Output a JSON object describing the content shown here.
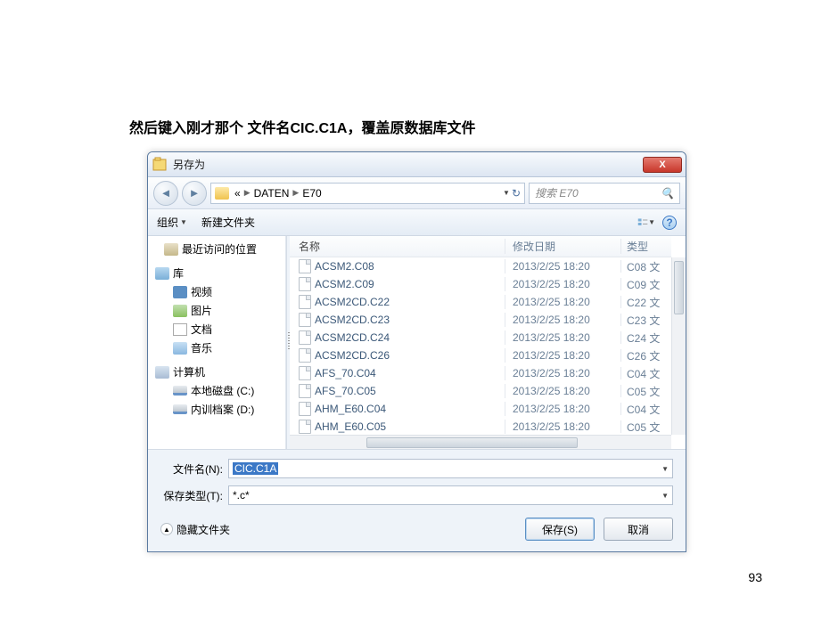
{
  "instruction": "然后键入刚才那个 文件名CIC.C1A，覆盖原数据库文件",
  "page_number": "93",
  "dialog": {
    "title": "另存为",
    "close_x": "X",
    "nav": {
      "bc_prefix": "«",
      "bc_part1": "DATEN",
      "bc_part2": "E70",
      "search_placeholder": "搜索 E70"
    },
    "toolbar": {
      "organize": "组织",
      "newfolder": "新建文件夹"
    },
    "sidebar": {
      "recent": "最近访问的位置",
      "libraries": "库",
      "video": "视频",
      "pictures": "图片",
      "documents": "文档",
      "music": "音乐",
      "computer": "计算机",
      "drive_c": "本地磁盘 (C:)",
      "drive_d": "内训档案 (D:)"
    },
    "filelist": {
      "col_name": "名称",
      "col_date": "修改日期",
      "col_type": "类型",
      "rows": [
        {
          "name": "ACSM2.C08",
          "date": "2013/2/25 18:20",
          "type": "C08 文"
        },
        {
          "name": "ACSM2.C09",
          "date": "2013/2/25 18:20",
          "type": "C09 文"
        },
        {
          "name": "ACSM2CD.C22",
          "date": "2013/2/25 18:20",
          "type": "C22 文"
        },
        {
          "name": "ACSM2CD.C23",
          "date": "2013/2/25 18:20",
          "type": "C23 文"
        },
        {
          "name": "ACSM2CD.C24",
          "date": "2013/2/25 18:20",
          "type": "C24 文"
        },
        {
          "name": "ACSM2CD.C26",
          "date": "2013/2/25 18:20",
          "type": "C26 文"
        },
        {
          "name": "AFS_70.C04",
          "date": "2013/2/25 18:20",
          "type": "C04 文"
        },
        {
          "name": "AFS_70.C05",
          "date": "2013/2/25 18:20",
          "type": "C05 文"
        },
        {
          "name": "AHM_E60.C04",
          "date": "2013/2/25 18:20",
          "type": "C04 文"
        },
        {
          "name": "AHM_E60.C05",
          "date": "2013/2/25 18:20",
          "type": "C05 文"
        }
      ]
    },
    "filename_label": "文件名(N):",
    "filename_value": "CIC.C1A",
    "filetype_label": "保存类型(T):",
    "filetype_value": "*.c*",
    "hide_folders": "隐藏文件夹",
    "save_btn": "保存(S)",
    "cancel_btn": "取消"
  }
}
